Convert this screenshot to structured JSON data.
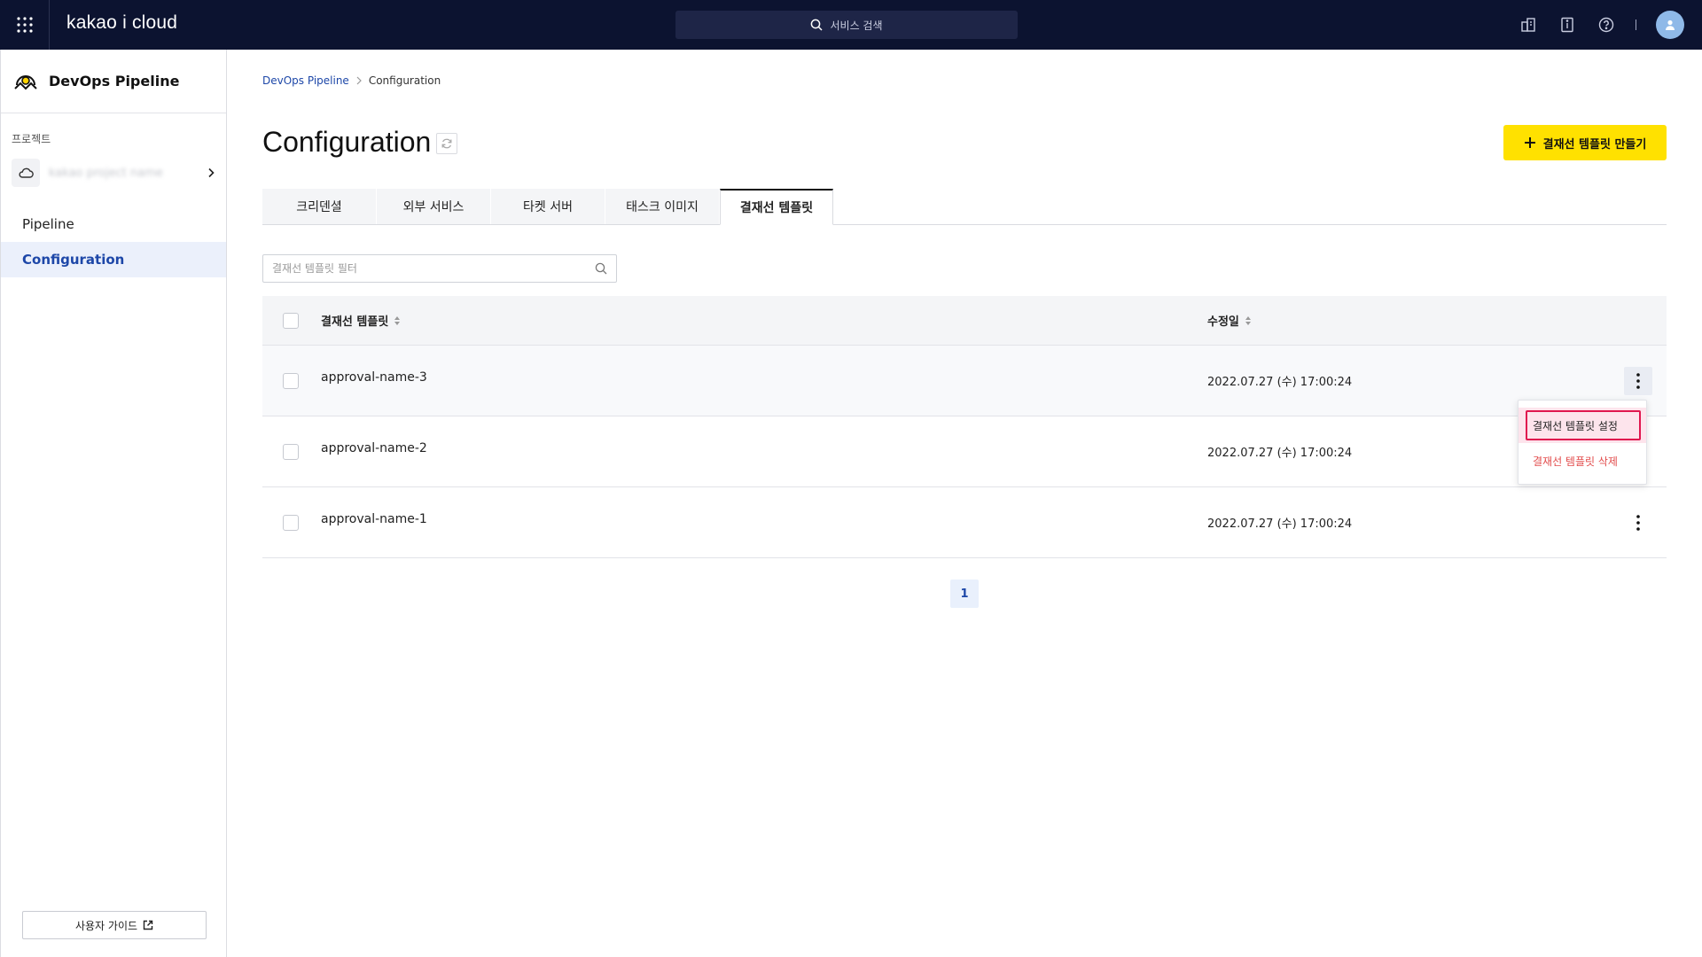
{
  "topbar": {
    "brand": "kakao i cloud",
    "search_placeholder": "서비스 검색"
  },
  "sidebar": {
    "title": "DevOps Pipeline",
    "section_label": "프로젝트",
    "project_name": "kakao project name",
    "nav": [
      {
        "label": "Pipeline",
        "active": false
      },
      {
        "label": "Configuration",
        "active": true
      }
    ],
    "guide_label": "사용자 가이드"
  },
  "breadcrumb": {
    "root": "DevOps Pipeline",
    "current": "Configuration"
  },
  "page": {
    "title": "Configuration",
    "create_button": "결재선 템플릿 만들기"
  },
  "tabs": [
    {
      "label": "크리덴셜",
      "active": false
    },
    {
      "label": "외부 서비스",
      "active": false
    },
    {
      "label": "타켓 서버",
      "active": false
    },
    {
      "label": "태스크 이미지",
      "active": false
    },
    {
      "label": "결재선 템플릿",
      "active": true
    }
  ],
  "filter": {
    "placeholder": "결재선 템플릿 필터"
  },
  "table": {
    "columns": [
      "결재선 템플릿",
      "수정일"
    ],
    "rows": [
      {
        "name": "approval-name-3",
        "modified": "2022.07.27 (수) 17:00:24"
      },
      {
        "name": "approval-name-2",
        "modified": "2022.07.27 (수) 17:00:24"
      },
      {
        "name": "approval-name-1",
        "modified": "2022.07.27 (수) 17:00:24"
      }
    ]
  },
  "context_menu": {
    "items": [
      "결재선 템플릿 설정",
      "결재선 템플릿 삭제"
    ]
  },
  "pagination": {
    "current": "1"
  },
  "colors": {
    "topbar": "#0c1330",
    "accent_link": "#1d47a8",
    "primary_button": "#ffe100",
    "danger": "#e24b4b",
    "highlight_border": "#e0174f"
  }
}
